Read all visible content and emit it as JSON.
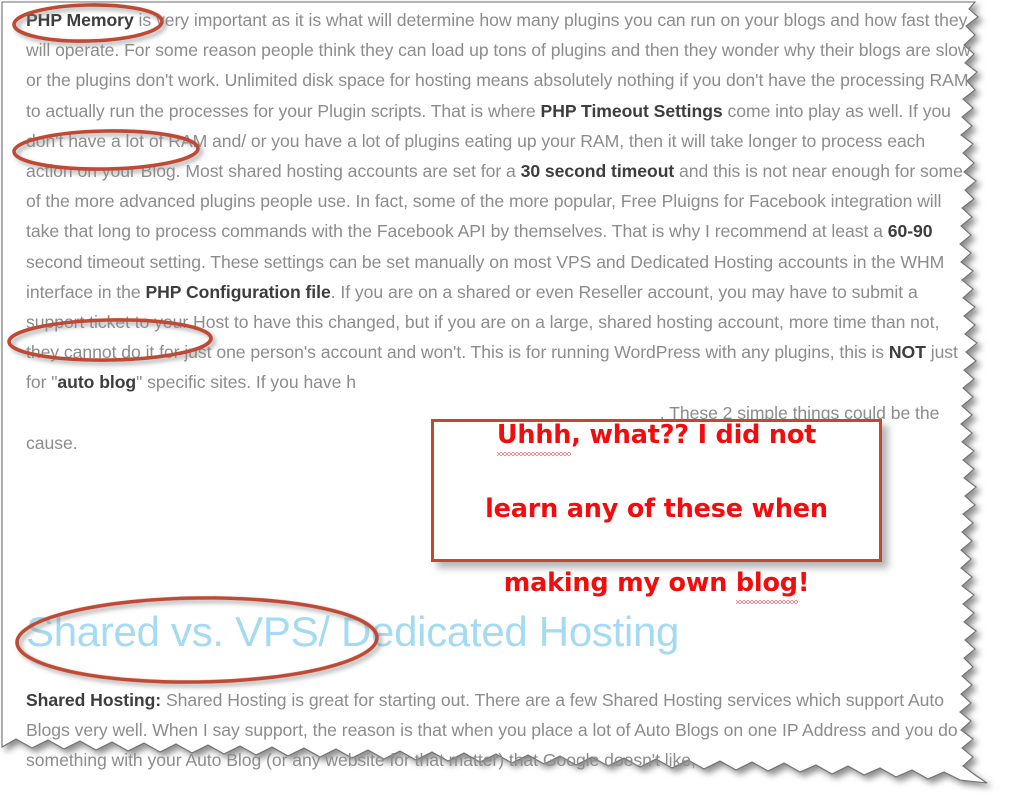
{
  "document": {
    "page_background": "#ffffff",
    "body_text_color": "#8c8c8c",
    "bold_text_color": "#3d3d3d",
    "heading_color": "#a4daf2",
    "annotation_color": "#bf4a32",
    "callout_text_color": "#f10d0d"
  },
  "paragraphs": {
    "php_memory_paragraph_html": "<b>PHP Memory</b> is very important as it is what will determine how many plugins you can run on your blogs and how fast they will operate.  For some reason people think they can load up tons of plugins and then they wonder why their blogs are slow or the plugins don't work.  Unlimited disk space for hosting means absolutely nothing if you don't have the processing RAM to actually run the processes for your Plugin scripts.  That is where <b>PHP Timeout Settings</b> come into play as well.  If you don't have a lot of RAM and/ or you have a lot of plugins eating up your RAM, then it will take longer to process each action on your Blog.  Most shared hosting accounts are set for a <b>30 second timeout</b> and this is not near enough for some of the more advanced plugins people use.  In fact, some of the more popular, Free Pluigns for Facebook integration will take that long to process commands with the Facebook API by themselves.  That is why I recommend at least a <b>60-90</b> second timeout setting.  These settings can be set manually on most VPS and Dedicated Hosting accounts in the WHM interface in the <b>PHP Configuration file</b>.  If you are on a shared or even Reseller account, you may have to submit a support ticket to your Host to have this changed, but if you are on a large, shared hosting account, more time than not, they cannot do it for just one person's account and won't. This is for running WordPress with any plugins, this is <b>NOT</b> just for \"<b>auto blog</b>\" specific sites.  If you have h&#8203;&nbsp;&nbsp;&nbsp;&nbsp;&nbsp;&nbsp;&nbsp;&nbsp;&nbsp;&nbsp;&nbsp;&nbsp;&nbsp;&nbsp;&nbsp;&nbsp;&nbsp;&nbsp;&nbsp;&nbsp;&nbsp;&nbsp;&nbsp;&nbsp;&nbsp;&nbsp;&nbsp;&nbsp;&nbsp;&nbsp;&nbsp;&nbsp;&nbsp;&nbsp;&nbsp;&nbsp;&nbsp;&nbsp;&nbsp;&nbsp;&nbsp;&nbsp;&nbsp;&nbsp;&nbsp;&nbsp;&nbsp;&nbsp;&nbsp;&nbsp;&nbsp;&nbsp;&nbsp;&nbsp;&nbsp;&nbsp;&nbsp;&nbsp;&nbsp;&nbsp;&nbsp;&nbsp;&nbsp;&nbsp;&nbsp;&nbsp;&nbsp;&nbsp;&nbsp;&nbsp;&nbsp;&nbsp;&nbsp;&nbsp;&nbsp;&nbsp;&nbsp;&nbsp;&nbsp;&nbsp;&nbsp;&nbsp;&nbsp;&nbsp;&nbsp;&nbsp;&nbsp;&nbsp;&nbsp;&nbsp;&nbsp;&nbsp;&nbsp;&nbsp;&nbsp;&nbsp;&nbsp;&nbsp;&nbsp;&nbsp;&nbsp;&nbsp;&nbsp;&nbsp;&nbsp;&nbsp;&nbsp;&nbsp;&nbsp;&nbsp;&nbsp;&nbsp;&nbsp;&nbsp;&nbsp;&nbsp;&nbsp;&nbsp;&nbsp;&nbsp;&nbsp;&nbsp;&nbsp;&nbsp;&nbsp;&nbsp;&nbsp;&nbsp;&nbsp;&nbsp;&nbsp;. These 2 simple things could be the cause.",
    "shared_hosting_paragraph_html": "<b>Shared Hosting:</b> Shared Hosting is great for starting out.  There are a few Shared Hosting services which support Auto Blogs very well.  When I say support, the reason is that when you place a lot of Auto Blogs on one IP Address and you do something with your Auto Blog (or any website for that matter) that Google doesn't like,"
  },
  "heading": {
    "text": "Shared vs. VPS/ Dedicated Hosting"
  },
  "callout": {
    "line1": "Uhhh, what?? I did not",
    "line2": "learn any of these when",
    "line3": "making my own blog!",
    "full_text": "Uhhh, what?? I did not learn any of these when making my own blog!",
    "spellcheck_words": [
      "Uhhh",
      "blog"
    ]
  },
  "annotations": [
    {
      "name": "ellipse-php-memory",
      "target": "PHP Memory"
    },
    {
      "name": "ellipse-timeout-settings",
      "target": "Timeout Settings"
    },
    {
      "name": "ellipse-configuration-file",
      "target": "Configuration file"
    },
    {
      "name": "ellipse-shared-vs-vps",
      "target": "Shared vs. VPS/"
    }
  ]
}
